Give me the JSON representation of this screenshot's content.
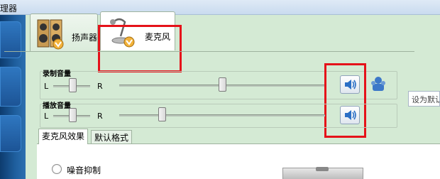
{
  "window": {
    "title_fragment": "理器"
  },
  "device_tabs": [
    {
      "label": "扬声器",
      "icon": "speakers-icon"
    },
    {
      "label": "麦克风",
      "icon": "microphone-icon"
    }
  ],
  "groups": {
    "recording": {
      "title": "录制音量",
      "left": "L",
      "right": "R"
    },
    "playback": {
      "title": "播放音量",
      "left": "L",
      "right": "R"
    }
  },
  "levels": {
    "recording_balance": 0.5,
    "recording_volume": 0.6,
    "playback_balance": 0.5,
    "playback_volume": 0.25
  },
  "set_default_field": {
    "value": "设为默认"
  },
  "sub_tabs": [
    {
      "label": "麦克风效果"
    },
    {
      "label": "默认格式"
    }
  ],
  "effects": {
    "noise_suppression": "噪音抑制"
  },
  "colors": {
    "highlight": "#e5121a",
    "panel": "#d4ead4"
  }
}
